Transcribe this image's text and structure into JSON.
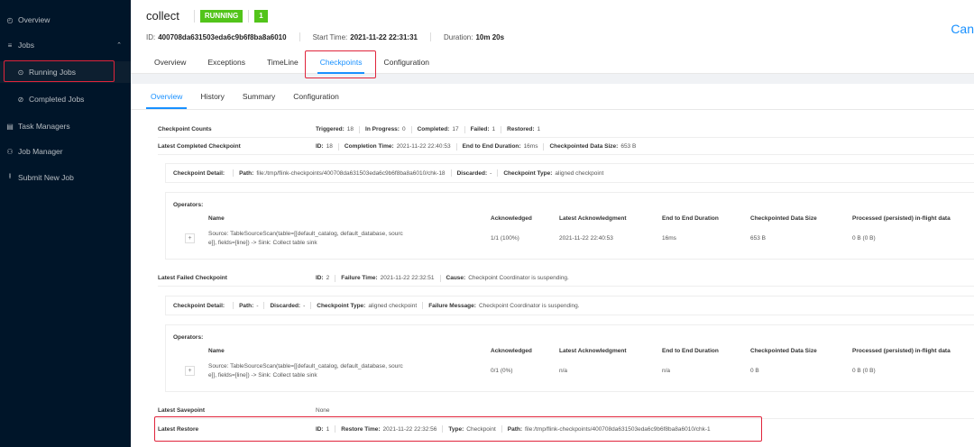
{
  "sidebar": {
    "items": [
      {
        "label": "Overview",
        "icon": "dashboard-icon"
      },
      {
        "label": "Jobs",
        "icon": "list-icon"
      },
      {
        "label": "Running Jobs",
        "icon": "play-circle-icon"
      },
      {
        "label": "Completed Jobs",
        "icon": "check-circle-icon"
      },
      {
        "label": "Task Managers",
        "icon": "server-icon"
      },
      {
        "label": "Job Manager",
        "icon": "cluster-icon"
      },
      {
        "label": "Submit New Job",
        "icon": "upload-icon"
      }
    ]
  },
  "header": {
    "job_name": "collect",
    "status": "RUNNING",
    "parallelism": "1",
    "cancel_label": "Can",
    "id_label": "ID:",
    "id_value": "400708da631503eda6c9b6f8ba8a6010",
    "start_label": "Start Time:",
    "start_value": "2021-11-22 22:31:31",
    "duration_label": "Duration:",
    "duration_value": "10m 20s",
    "tabs": [
      "Overview",
      "Exceptions",
      "TimeLine",
      "Checkpoints",
      "Configuration"
    ],
    "active_tab": "Checkpoints"
  },
  "subtabs": [
    "Overview",
    "History",
    "Summary",
    "Configuration"
  ],
  "counts": {
    "label": "Checkpoint Counts",
    "triggered_label": "Triggered:",
    "triggered": "18",
    "in_progress_label": "In Progress:",
    "in_progress": "0",
    "completed_label": "Completed:",
    "completed": "17",
    "failed_label": "Failed:",
    "failed": "1",
    "restored_label": "Restored:",
    "restored": "1"
  },
  "latest_completed": {
    "label": "Latest Completed Checkpoint",
    "id_label": "ID:",
    "id": "18",
    "completion_label": "Completion Time:",
    "completion": "2021-11-22 22:40:53",
    "e2e_label": "End to End Duration:",
    "e2e": "16ms",
    "size_label": "Checkpointed Data Size:",
    "size": "653 B",
    "detail_label": "Checkpoint Detail:",
    "path_label": "Path:",
    "path": "file:/tmp/flink-checkpoints/400708da631503eda6c9b6f8ba8a6010/chk-18",
    "discarded_label": "Discarded:",
    "discarded": "-",
    "type_label": "Checkpoint Type:",
    "type": "aligned checkpoint"
  },
  "operators_label": "Operators:",
  "op_headers": [
    "Name",
    "Acknowledged",
    "Latest Acknowledgment",
    "End to End Duration",
    "Checkpointed Data Size",
    "Processed (persisted) in-flight data"
  ],
  "op1": {
    "name_line1": "Source: TableSourceScan(table=[[default_catalog, default_database, sourc",
    "name_line2": "e]], fields=[line]) -> Sink: Collect table sink",
    "ack": "1/1 (100%)",
    "latest_ack": "2021-11-22 22:40:53",
    "e2e": "16ms",
    "size": "653 B",
    "inflight": "0 B (0 B)"
  },
  "latest_failed": {
    "label": "Latest Failed Checkpoint",
    "id_label": "ID:",
    "id": "2",
    "failure_label": "Failure Time:",
    "failure": "2021-11-22 22:32:51",
    "cause_label": "Cause:",
    "cause": "Checkpoint Coordinator is suspending.",
    "detail_label": "Checkpoint Detail:",
    "path_label": "Path:",
    "path": "-",
    "discarded_label": "Discarded:",
    "discarded": "-",
    "type_label": "Checkpoint Type:",
    "type": "aligned checkpoint",
    "msg_label": "Failure Message:",
    "msg": "Checkpoint Coordinator is suspending."
  },
  "op2": {
    "name_line1": "Source: TableSourceScan(table=[[default_catalog, default_database, sourc",
    "name_line2": "e]], fields=[line]) -> Sink: Collect table sink",
    "ack": "0/1 (0%)",
    "latest_ack": "n/a",
    "e2e": "n/a",
    "size": "0 B",
    "inflight": "0 B (0 B)"
  },
  "savepoint": {
    "label": "Latest Savepoint",
    "value": "None"
  },
  "restore": {
    "label": "Latest Restore",
    "id_label": "ID:",
    "id": "1",
    "time_label": "Restore Time:",
    "time": "2021-11-22 22:32:56",
    "type_label": "Type:",
    "type": "Checkpoint",
    "path_label": "Path:",
    "path": "file:/tmp/flink-checkpoints/400708da631503eda6c9b6f8ba8a6010/chk-1"
  }
}
